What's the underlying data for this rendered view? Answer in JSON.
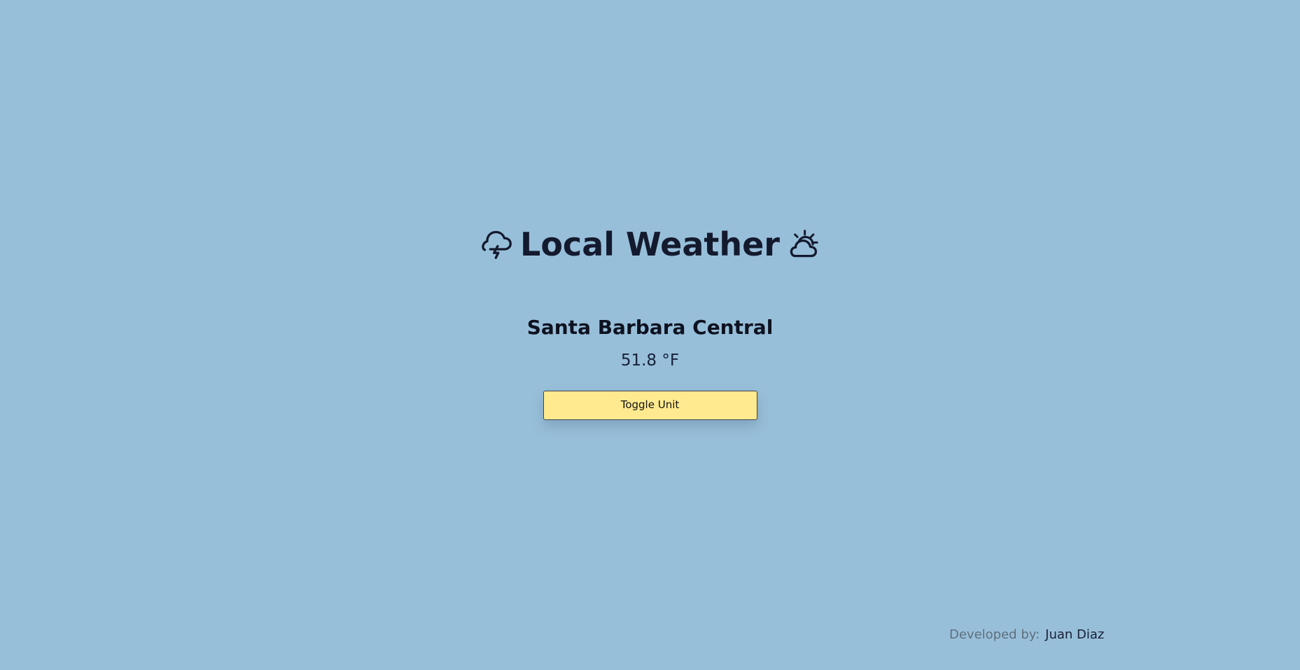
{
  "header": {
    "title": "Local Weather",
    "left_icon": "storm-cloud-icon",
    "right_icon": "partly-sunny-icon"
  },
  "weather": {
    "location": "Santa Barbara Central",
    "temperature": "51.8 °F"
  },
  "controls": {
    "toggle_label": "Toggle Unit"
  },
  "footer": {
    "label": "Developed by:",
    "developer": "Juan Diaz"
  },
  "colors": {
    "background": "#98bfd9",
    "button": "#ffea8f",
    "heading": "#141a2e"
  }
}
